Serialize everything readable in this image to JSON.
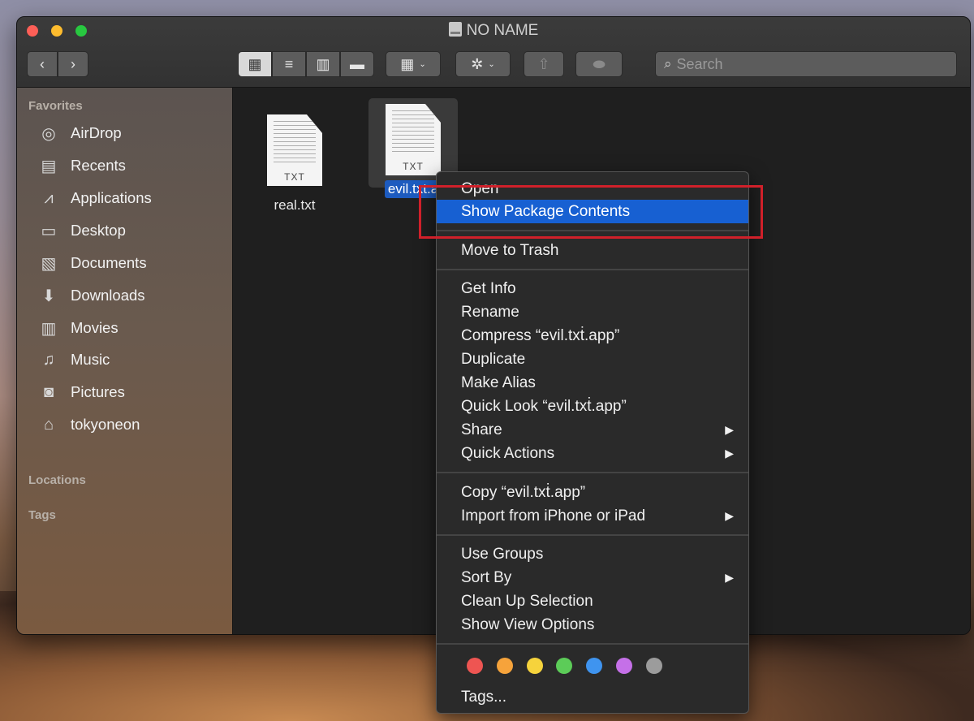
{
  "window": {
    "title": "NO NAME"
  },
  "toolbar": {
    "back_icon": "‹",
    "forward_icon": "›",
    "view_icons": [
      "▦",
      "≡",
      "▥",
      "▬"
    ],
    "group_icon": "▦",
    "action_icon": "✲",
    "caret_icon": "⌄",
    "share_icon": "⇧",
    "tag_icon": "⬬",
    "search": {
      "icon": "⌕",
      "placeholder": "Search"
    }
  },
  "sidebar": {
    "favorites_header": "Favorites",
    "locations_header": "Locations",
    "tags_header": "Tags",
    "items": [
      {
        "label": "AirDrop",
        "icon": "◎"
      },
      {
        "label": "Recents",
        "icon": "▤"
      },
      {
        "label": "Applications",
        "icon": "⩘"
      },
      {
        "label": "Desktop",
        "icon": "▭"
      },
      {
        "label": "Documents",
        "icon": "▧"
      },
      {
        "label": "Downloads",
        "icon": "⬇"
      },
      {
        "label": "Movies",
        "icon": "▥"
      },
      {
        "label": "Music",
        "icon": "♫"
      },
      {
        "label": "Pictures",
        "icon": "◙"
      },
      {
        "label": "tokyoneon",
        "icon": "⌂"
      }
    ]
  },
  "files": [
    {
      "name": "real.txt",
      "ext": "TXT"
    },
    {
      "name": "evil.txt.a",
      "ext": "TXT"
    }
  ],
  "context_menu": {
    "items": [
      {
        "label": "Open"
      },
      {
        "label": "Show Package Contents"
      },
      {
        "label": "Move to Trash"
      },
      {
        "label": "Get Info"
      },
      {
        "label": "Rename"
      },
      {
        "label": "Compress “evil.txṫ.app”"
      },
      {
        "label": "Duplicate"
      },
      {
        "label": "Make Alias"
      },
      {
        "label": "Quick Look “evil.txṫ.app”"
      },
      {
        "label": "Share"
      },
      {
        "label": "Quick Actions"
      },
      {
        "label": "Copy “evil.txṫ.app”"
      },
      {
        "label": "Import from iPhone or iPad"
      },
      {
        "label": "Use Groups"
      },
      {
        "label": "Sort By"
      },
      {
        "label": "Clean Up Selection"
      },
      {
        "label": "Show View Options"
      },
      {
        "label": "Tags..."
      }
    ],
    "submenu_arrow": "▶",
    "tag_colors": [
      "#ee5552",
      "#f6a33b",
      "#f6d33c",
      "#5ccc58",
      "#3f94ef",
      "#c570e8",
      "#9c9c9c"
    ]
  },
  "annotation": {
    "highlight_color": "#d0202a"
  }
}
